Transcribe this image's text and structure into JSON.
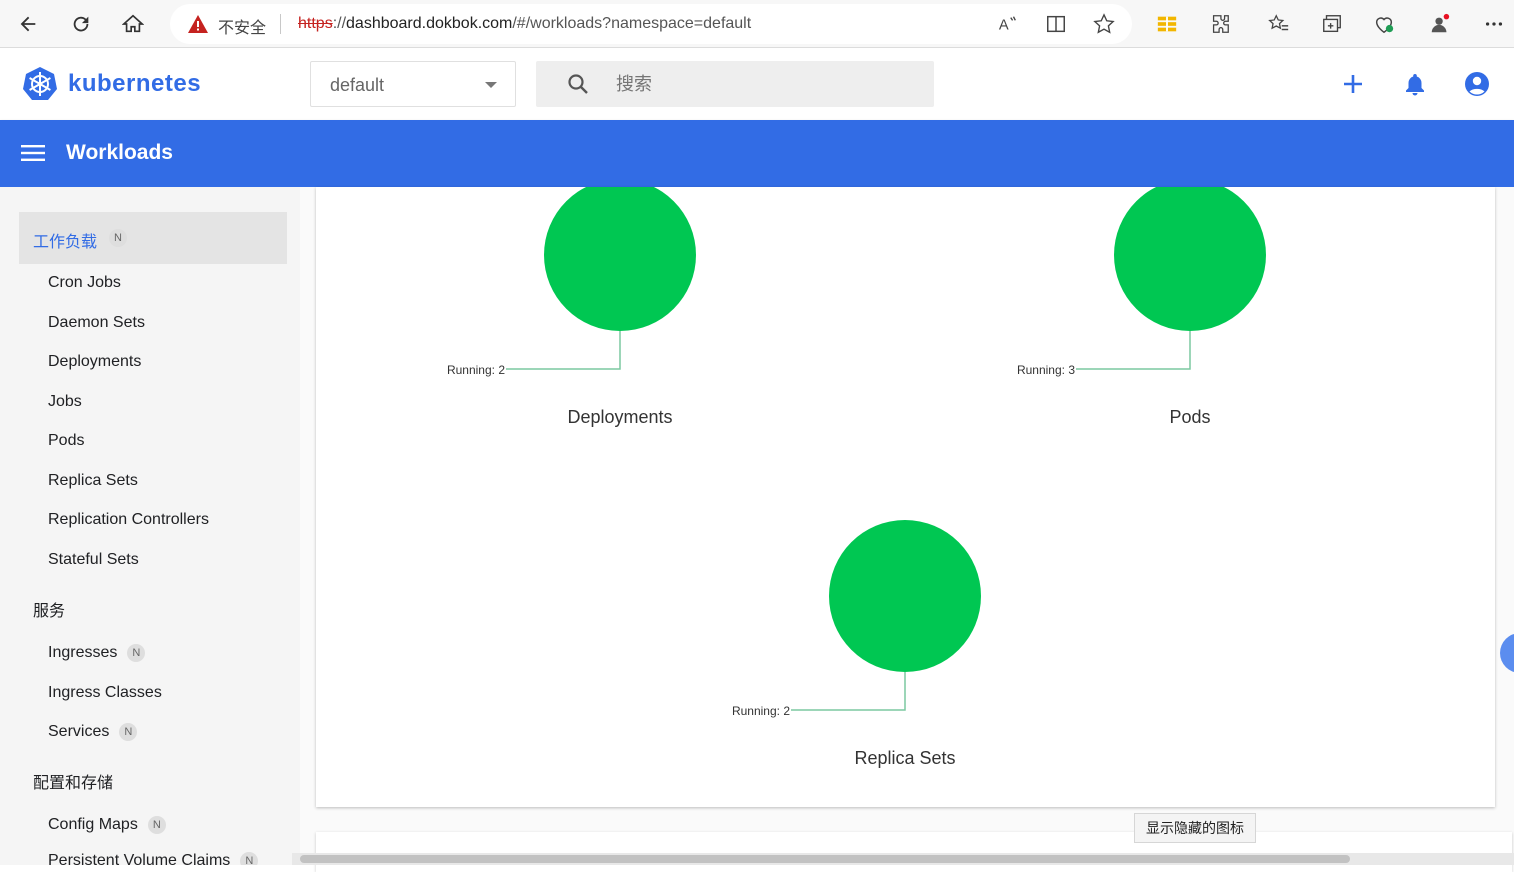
{
  "browser": {
    "insecure_label": "不安全",
    "url_scheme": "https",
    "url_sep": "://",
    "url_host": "dashboard.dokbok.com",
    "url_path": "/#/workloads?namespace=default"
  },
  "header": {
    "brand": "kubernetes",
    "namespace": "default",
    "search_placeholder": "搜索",
    "accent_color": "#326ce5"
  },
  "titlebar": {
    "title": "Workloads"
  },
  "sidebar": {
    "active_section": {
      "label": "工作负载",
      "badge": "N"
    },
    "workload_items": [
      "Cron Jobs",
      "Daemon Sets",
      "Deployments",
      "Jobs",
      "Pods",
      "Replica Sets",
      "Replication Controllers",
      "Stateful Sets"
    ],
    "service_section": "服务",
    "service_items": [
      {
        "label": "Ingresses",
        "badge": "N"
      },
      {
        "label": "Ingress Classes",
        "badge": ""
      },
      {
        "label": "Services",
        "badge": "N"
      }
    ],
    "config_section": "配置和存储",
    "config_items": [
      {
        "label": "Config Maps",
        "badge": "N"
      },
      {
        "label": "Persistent Volume Claims",
        "badge": "N"
      }
    ]
  },
  "chart_data": [
    {
      "type": "pie",
      "title": "Deployments",
      "categories": [
        "Running"
      ],
      "values": [
        2
      ],
      "label": "Running: 2",
      "color": "#00c752"
    },
    {
      "type": "pie",
      "title": "Pods",
      "categories": [
        "Running"
      ],
      "values": [
        3
      ],
      "label": "Running: 3",
      "color": "#00c752"
    },
    {
      "type": "pie",
      "title": "Replica Sets",
      "categories": [
        "Running"
      ],
      "values": [
        2
      ],
      "label": "Running: 2",
      "color": "#00c752"
    }
  ],
  "tooltip": "显示隐藏的图标"
}
